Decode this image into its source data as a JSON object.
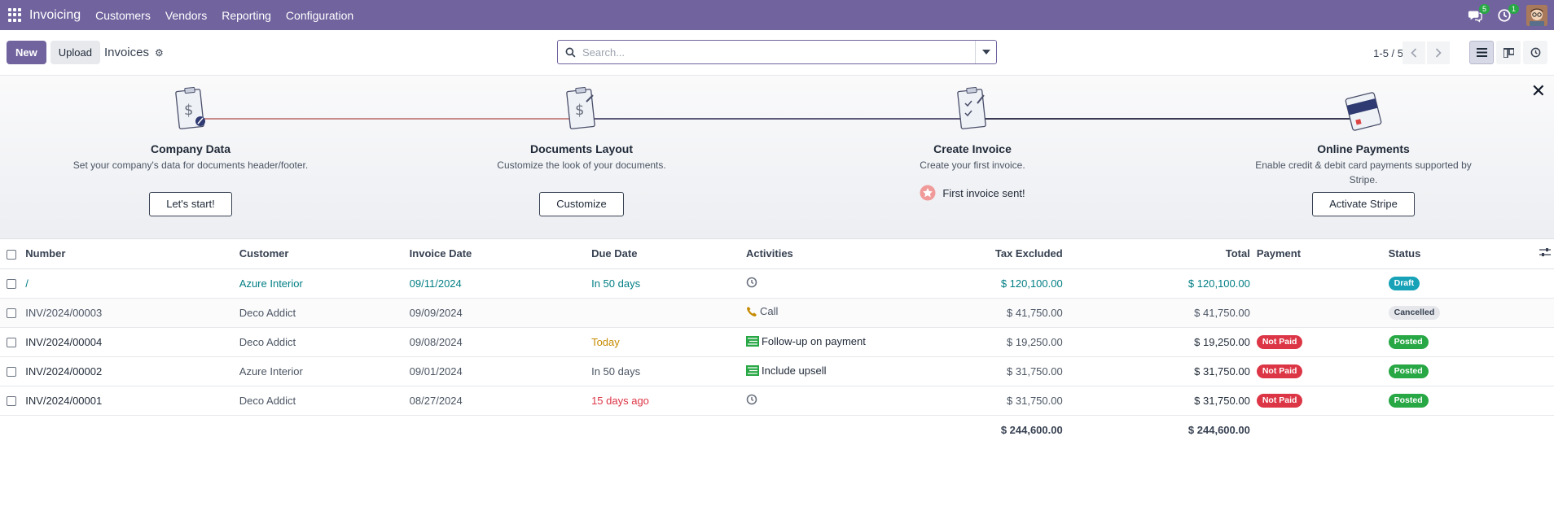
{
  "navbar": {
    "app_name": "Invoicing",
    "menu": [
      "Customers",
      "Vendors",
      "Reporting",
      "Configuration"
    ],
    "messages_count": "5",
    "activities_count": "1"
  },
  "control": {
    "new_label": "New",
    "upload_label": "Upload",
    "title": "Invoices",
    "search_placeholder": "Search...",
    "pager": "1-5 / 5"
  },
  "onboarding": {
    "steps": [
      {
        "title": "Company Data",
        "desc": "Set your company's data for documents header/footer.",
        "button": "Let's start!"
      },
      {
        "title": "Documents Layout",
        "desc": "Customize the look of your documents.",
        "button": "Customize"
      },
      {
        "title": "Create Invoice",
        "desc": "Create your first invoice.",
        "done": "First invoice sent!"
      },
      {
        "title": "Online Payments",
        "desc": "Enable credit & debit card payments supported by Stripe.",
        "button": "Activate Stripe"
      }
    ]
  },
  "table": {
    "headers": {
      "number": "Number",
      "customer": "Customer",
      "invoice_date": "Invoice Date",
      "due_date": "Due Date",
      "activities": "Activities",
      "tax_excluded": "Tax Excluded",
      "total": "Total",
      "payment": "Payment",
      "status": "Status"
    },
    "rows": [
      {
        "number": "/",
        "customer": "Azure Interior",
        "invoice_date": "09/11/2024",
        "due_date": "In 50 days",
        "activity": "",
        "activity_icon": "clock-icon",
        "tax_excluded": "$ 120,100.00",
        "total": "$ 120,100.00",
        "payment": "",
        "status": "Draft"
      },
      {
        "number": "INV/2024/00003",
        "customer": "Deco Addict",
        "invoice_date": "09/09/2024",
        "due_date": "",
        "activity": "Call",
        "activity_icon": "phone-icon",
        "tax_excluded": "$ 41,750.00",
        "total": "$ 41,750.00",
        "payment": "",
        "status": "Cancelled"
      },
      {
        "number": "INV/2024/00004",
        "customer": "Deco Addict",
        "invoice_date": "09/08/2024",
        "due_date": "Today",
        "activity": "Follow-up on payment",
        "activity_icon": "tasks-icon",
        "tax_excluded": "$ 19,250.00",
        "total": "$ 19,250.00",
        "payment": "Not Paid",
        "status": "Posted"
      },
      {
        "number": "INV/2024/00002",
        "customer": "Azure Interior",
        "invoice_date": "09/01/2024",
        "due_date": "In 50 days",
        "activity": "Include upsell",
        "activity_icon": "tasks-icon",
        "tax_excluded": "$ 31,750.00",
        "total": "$ 31,750.00",
        "payment": "Not Paid",
        "status": "Posted"
      },
      {
        "number": "INV/2024/00001",
        "customer": "Deco Addict",
        "invoice_date": "08/27/2024",
        "due_date": "15 days ago",
        "activity": "",
        "activity_icon": "clock-icon",
        "tax_excluded": "$ 31,750.00",
        "total": "$ 31,750.00",
        "payment": "Not Paid",
        "status": "Posted"
      }
    ],
    "footer": {
      "tax_excluded": "$ 244,600.00",
      "total": "$ 244,600.00"
    }
  },
  "colors": {
    "brand": "#71639e",
    "draft": "#17a2b8",
    "posted": "#28a745",
    "not_paid": "#dc3545",
    "link": "#017e84"
  }
}
